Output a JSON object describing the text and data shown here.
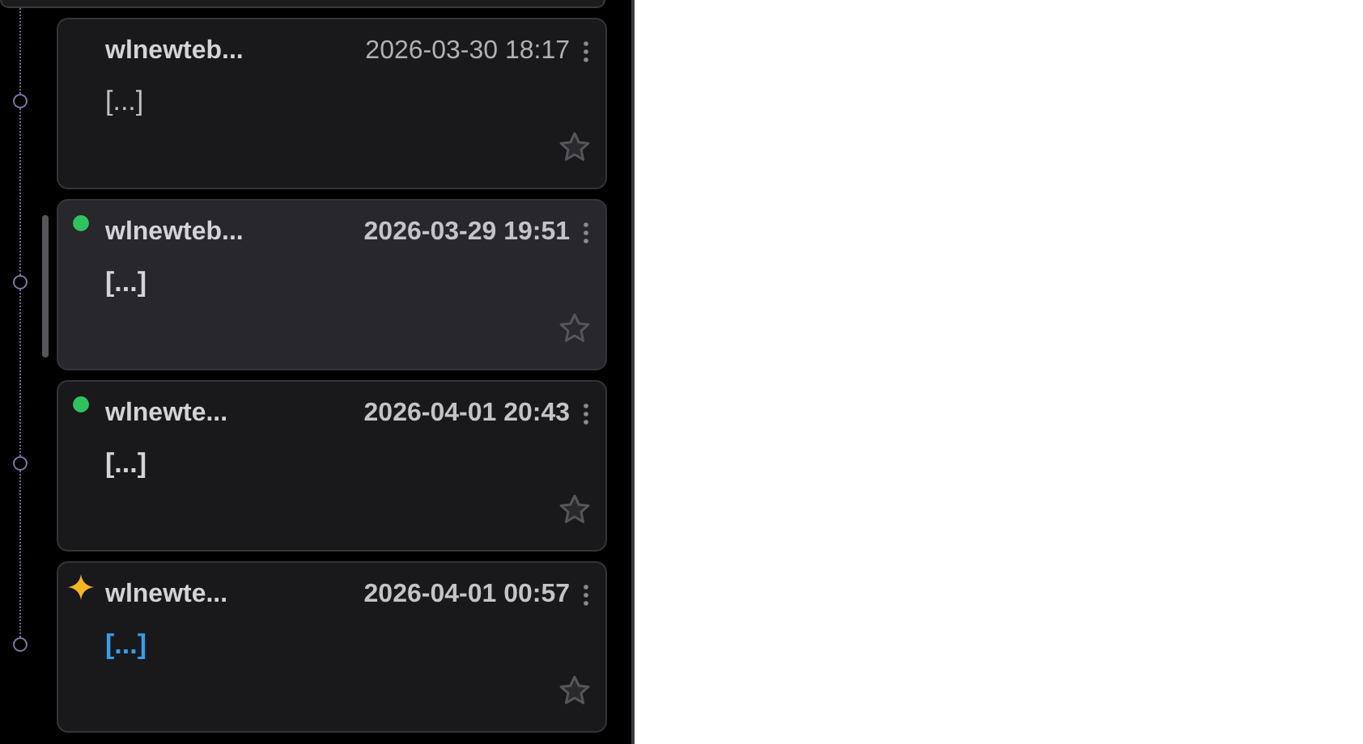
{
  "messages": [
    {
      "title": "wlnewteb...",
      "time": "2026-03-30 18:17",
      "preview": "[...]",
      "kind": "none",
      "unread": false,
      "accent": false,
      "selected": false,
      "starred": false
    },
    {
      "title": "wlnewteb...",
      "time": "2026-03-29 19:51",
      "preview": "[...]",
      "kind": "dot",
      "unread": true,
      "accent": false,
      "selected": true,
      "starred": false
    },
    {
      "title": "wlnewte...",
      "time": "2026-04-01 20:43",
      "preview": "[...]",
      "kind": "dot",
      "unread": true,
      "accent": false,
      "selected": false,
      "starred": false
    },
    {
      "title": "wlnewte...",
      "time": "2026-04-01 00:57",
      "preview": "[...]",
      "kind": "sparkle",
      "unread": true,
      "accent": true,
      "selected": false,
      "starred": false
    }
  ]
}
